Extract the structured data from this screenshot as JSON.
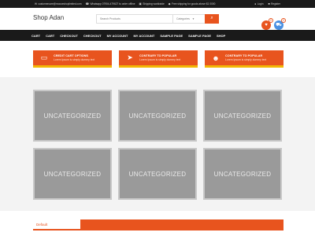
{
  "topbar": {
    "email": "customercare@mouseshoplimited.com",
    "phone": "Whatsapp 07904-479627 to order offline",
    "shipping": "Shipping worldwide",
    "free_shipping": "Free shipping for goods above $1 0000",
    "login": "Login",
    "register": "Register"
  },
  "header": {
    "logo": "Shop Adan",
    "search_placeholder": "Search Products",
    "category_label": "Categories",
    "wishlist_count": "0",
    "cart_count": "0"
  },
  "nav": {
    "items": [
      "CART",
      "CART",
      "CHECKOUT",
      "CHECKOUT",
      "MY ACCOUNT",
      "MY ACCOUNT",
      "SAMPLE PAGE",
      "SAMPLE PAGE",
      "SHOP"
    ]
  },
  "features": [
    {
      "title": "CREDIT CART OPTIONS",
      "desc": "Lorem Ipsum is simply dummy text",
      "icon": "credit-card-icon"
    },
    {
      "title": "CONTRARY TO POPULAR",
      "desc": "Lorem Ipsum is simply dummy text",
      "icon": "paper-plane-icon"
    },
    {
      "title": "CONTRARY TO POPULAR",
      "desc": "Lorem Ipsum is simply dummy text",
      "icon": "users-icon"
    }
  ],
  "categories": [
    "UNCATEGORIZED",
    "UNCATEGORIZED",
    "UNCATEGORIZED",
    "UNCATEGORIZED",
    "UNCATEGORIZED",
    "UNCATEGORIZED"
  ],
  "bottom_tab": "Default",
  "colors": {
    "accent": "#e8541e",
    "accent_stripe": "#f2b705",
    "dark": "#1a1a1a",
    "cart_button": "#4a90e2"
  }
}
